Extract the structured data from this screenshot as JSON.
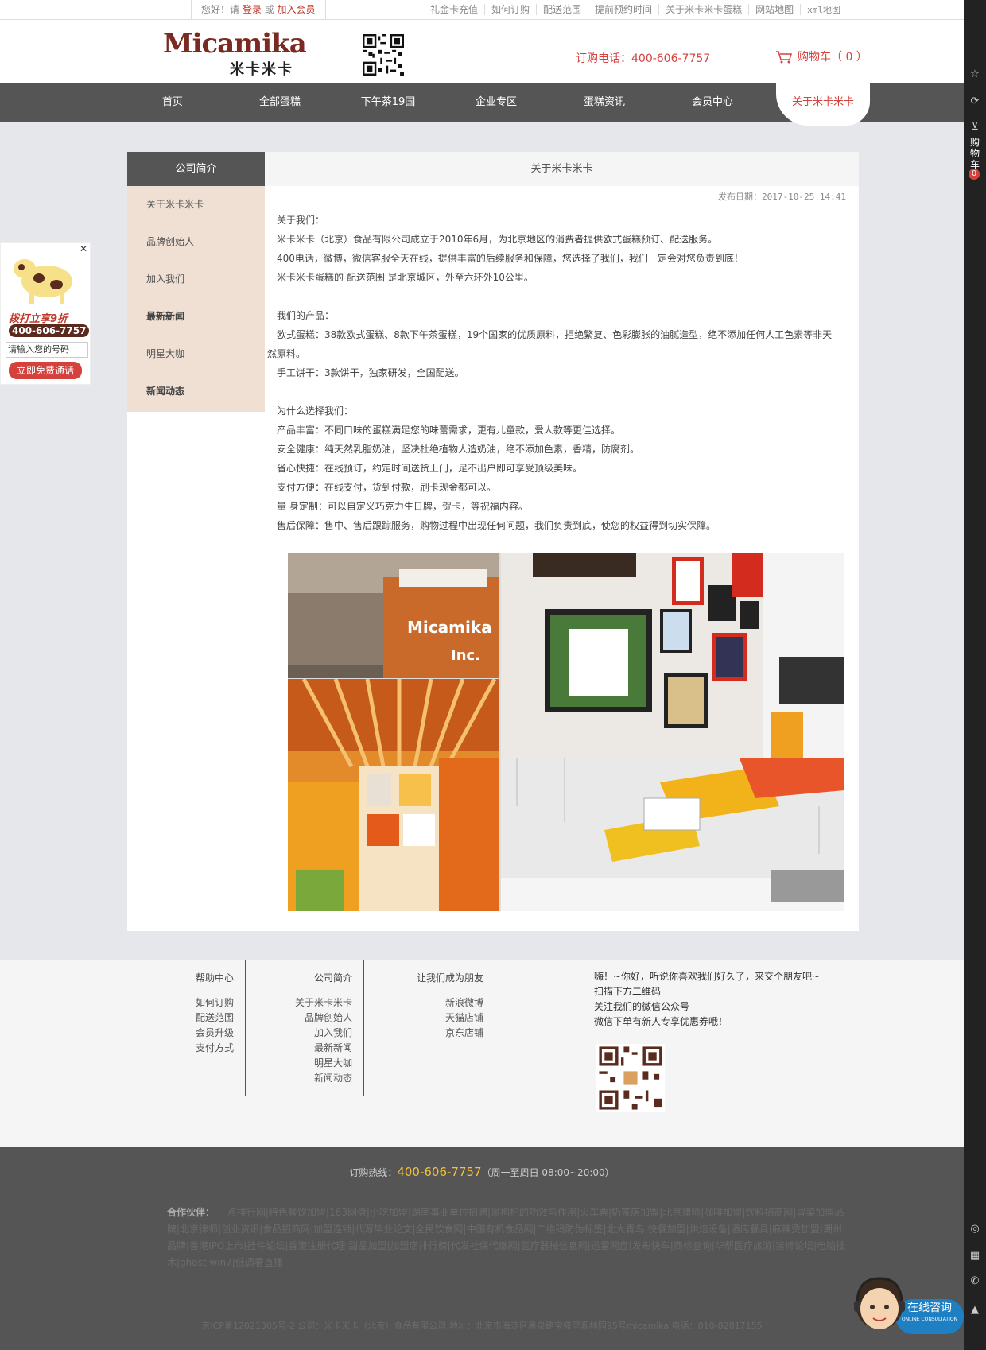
{
  "topbar": {
    "greet1": "您好！请",
    "login": "登录",
    "or": "或",
    "join": "加入会员",
    "links": [
      "礼金卡充值",
      "如何订购",
      "配送范围",
      "提前预约时间",
      "关于米卡米卡蛋糕",
      "网站地图",
      "xml地图"
    ]
  },
  "header": {
    "logo_text": "Micamika",
    "logo_cn": "米卡米卡",
    "phone": "订购电话：400-606-7757",
    "cart": "购物车（ 0 ）"
  },
  "nav": [
    "首页",
    "全部蛋糕",
    "下午茶19国",
    "企业专区",
    "蛋糕资讯",
    "会员中心",
    "关于米卡米卡"
  ],
  "sidebar": {
    "title": "公司简介",
    "items": [
      {
        "label": "关于米卡米卡"
      },
      {
        "label": "品牌创始人"
      },
      {
        "label": "加入我们"
      },
      {
        "label": "最新新闻"
      },
      {
        "label": "明星大咖"
      },
      {
        "label": "新闻动态"
      }
    ]
  },
  "article": {
    "title": "关于米卡米卡",
    "date": "发布日期：2017-10-25 14:41",
    "lines": [
      "关于我们：",
      "米卡米卡（北京）食品有限公司成立于2010年6月，为北京地区的消费者提供欧式蛋糕预订、配送服务。",
      "400电话，微博，微信客服全天在线，提供丰富的后续服务和保障，您选择了我们，我们一定会对您负责到底！",
      "米卡米卡蛋糕的 配送范围 是北京城区，外至六环外10公里。",
      "",
      "我们的产品：",
      "欧式蛋糕：38款欧式蛋糕、8款下午茶蛋糕，19个国家的优质原料，拒绝繁复、色彩膨胀的油腻造型，绝不添加任何人工色素等非天",
      "然原料。",
      "手工饼干：3款饼干，独家研发，全国配送。",
      "",
      "为什么选择我们：",
      "产品丰富：不同口味的蛋糕满足您的味蕾需求，更有儿童款，爱人款等更佳选择。",
      "安全健康：纯天然乳脂奶油，坚决杜绝植物人造奶油，绝不添加色素，香精，防腐剂。",
      "省心快捷：在线预订，约定时间送货上门，足不出户即可享受顶级美味。",
      "支付方便：在线支付，货到付款，刷卡现金都可以。",
      "量 身定制：可以自定义巧克力生日牌，贺卡，等祝福内容。",
      "售后保障：售中、售后跟踪服务，购物过程中出现任何问题，我们负责到底，使您的权益得到切实保障。"
    ],
    "photo_sign": "Micamika",
    "photo_sign2": "Inc."
  },
  "footer": {
    "cols": [
      {
        "title": "帮助中心",
        "links": [
          "如何订购",
          "配送范围",
          "会员升级",
          "支付方式"
        ]
      },
      {
        "title": "公司简介",
        "links": [
          "关于米卡米卡",
          "品牌创始人",
          "加入我们",
          "最新新闻",
          "明星大咖",
          "新闻动态"
        ]
      },
      {
        "title": "让我们成为朋友",
        "links": [
          "新浪微博",
          "天猫店铺",
          "京东店铺"
        ]
      }
    ],
    "wechat": [
      "嗨！~你好，听说你喜欢我们好久了，来交个朋友吧~",
      "扫描下方二维码",
      "关注我们的微信公众号",
      "微信下单有新人专享优惠券哦！"
    ]
  },
  "bottom": {
    "hotline_label": "订购热线：",
    "hotline": "400-606-7757",
    "hours": "（周一至周日 08:00~20:00）",
    "partners_label": "合作伙伴：",
    "partners": [
      "一点排行网",
      "特色餐饮加盟",
      "163网盘",
      "小吃加盟",
      "湖南事业单位招聘",
      "黑枸杞的功效与作用",
      "火车票",
      "奶茶店加盟",
      "北京律师",
      "咖啡加盟",
      "饮料招商网",
      "冒菜加盟品牌",
      "北京律师",
      "创业资讯",
      "食品招商网",
      "加盟连锁",
      "代写毕业论文",
      "全民饮食网",
      "中国有机食品网",
      "二维码防伪标签",
      "北大青鸟",
      "快餐加盟",
      "烘焙设备",
      "酒店餐具",
      "麻辣烫加盟",
      "潮州品牌",
      "香港IPO上市",
      "挂件论坛",
      "香港注册代理",
      "甜品加盟",
      "加盟店排行榜",
      "代发社保代缴网",
      "医疗器械信息网",
      "迅雷网盘",
      "发布快车",
      "商标查询",
      "华帮医疗旅游",
      "装修论坛",
      "电脑技术",
      "ghost win7",
      "低调看直播"
    ],
    "icp": "京ICP备12021305号-2 公司：米卡米卡（北京）食品有限公司 地址：北京市海淀区黑泉路宝盛里观林园95号micamika 电话：010-82817155"
  },
  "left_ad": {
    "slogan": "拨打立享9折",
    "tel": "400-606-7757",
    "input_placeholder": "请输入您的号码",
    "button": "立即免费通话"
  },
  "right_rail": {
    "cart_label": "购物车",
    "cart_count": "0"
  },
  "consult": {
    "label": "在线咨询",
    "sub": "ONLINE CONSULTATION"
  }
}
